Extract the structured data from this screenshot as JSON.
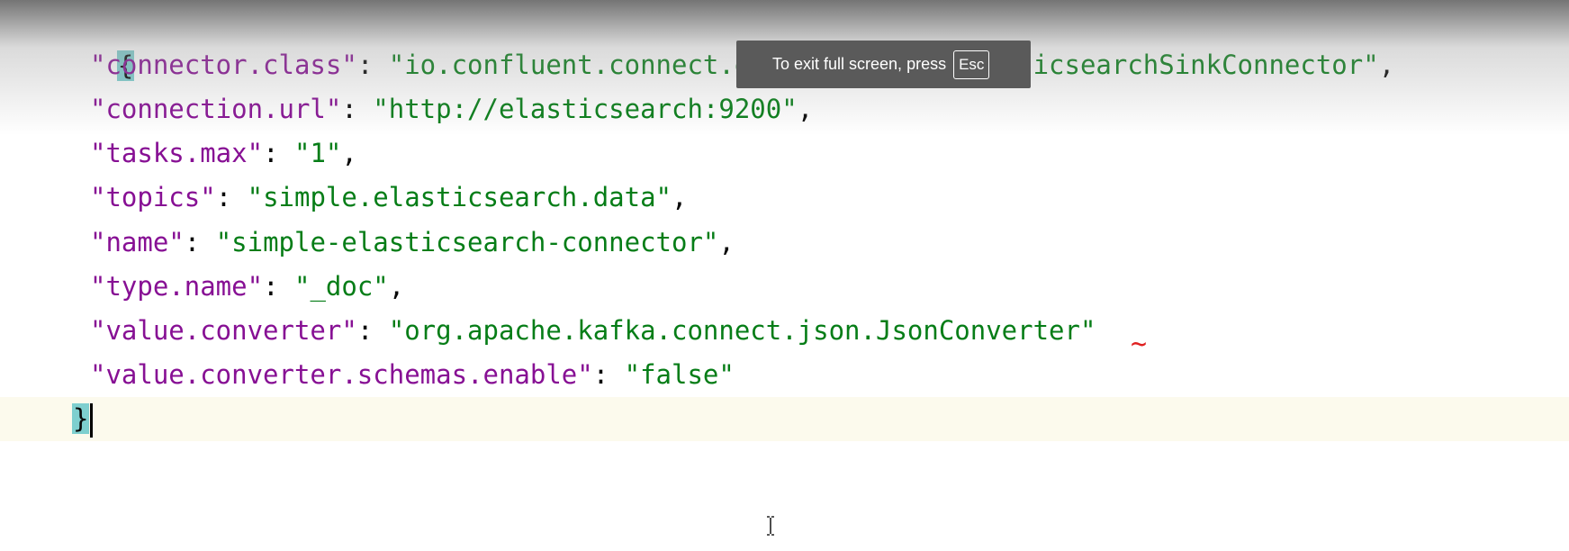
{
  "editor": {
    "open_brace": "{",
    "close_brace": "}",
    "lines": [
      {
        "key": "\"connector.class\"",
        "value": "\"io.confluent.connect.elasticsearch.ElasticsearchSinkConnector\"",
        "trail": ","
      },
      {
        "key": "\"connection.url\"",
        "value": "\"http://elasticsearch:9200\"",
        "trail": ","
      },
      {
        "key": "\"tasks.max\"",
        "value": "\"1\"",
        "trail": ","
      },
      {
        "key": "\"topics\"",
        "value": "\"simple.elasticsearch.data\"",
        "trail": ","
      },
      {
        "key": "\"name\"",
        "value": "\"simple-elasticsearch-connector\"",
        "trail": ","
      },
      {
        "key": "\"type.name\"",
        "value": "\"_doc\"",
        "trail": ","
      },
      {
        "key": "\"value.converter\"",
        "value": "\"org.apache.kafka.connect.json.JsonConverter\"",
        "trail": ""
      },
      {
        "key": "\"value.converter.schemas.enable\"",
        "value": "\"false\"",
        "trail": ""
      }
    ],
    "separator": ": ",
    "error_marker": "~"
  },
  "fullscreen_notice": {
    "text": "To exit full screen, press",
    "key_label": "Esc"
  },
  "icons": {
    "cursor": "text-cursor-icon"
  },
  "colors": {
    "key": "#871094",
    "string": "#067d17",
    "brace_highlight": "#7ecfcf",
    "current_line": "#fcfaed",
    "error": "#e02020"
  }
}
